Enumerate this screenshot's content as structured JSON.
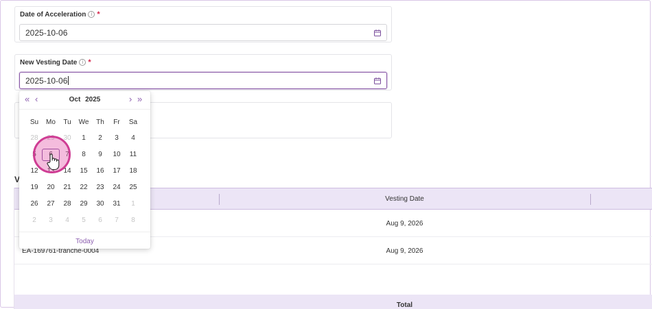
{
  "form": {
    "acceleration": {
      "label": "Date of Acceleration",
      "info_icon": "info-icon",
      "required_mark": "*",
      "value": "2025-10-06"
    },
    "new_vesting": {
      "label": "New Vesting Date",
      "info_icon": "info-icon",
      "required_mark": "*",
      "value": "2025-10-06"
    }
  },
  "calendar": {
    "nav": {
      "prev_year": "«",
      "prev_month": "‹",
      "next_month": "›",
      "next_year": "»"
    },
    "month": "Oct",
    "year": "2025",
    "weekdays": [
      "Su",
      "Mo",
      "Tu",
      "We",
      "Th",
      "Fr",
      "Sa"
    ],
    "weeks": [
      [
        "28",
        "29",
        "30",
        "1",
        "2",
        "3",
        "4"
      ],
      [
        "5",
        "6",
        "7",
        "8",
        "9",
        "10",
        "11"
      ],
      [
        "12",
        "13",
        "14",
        "15",
        "16",
        "17",
        "18"
      ],
      [
        "19",
        "20",
        "21",
        "22",
        "23",
        "24",
        "25"
      ],
      [
        "26",
        "27",
        "28",
        "29",
        "30",
        "31",
        "1"
      ],
      [
        "2",
        "3",
        "4",
        "5",
        "6",
        "7",
        "8"
      ]
    ],
    "selected_day": "6",
    "today_label": "Today"
  },
  "table": {
    "section_heading": "V",
    "columns": [
      "",
      "Vesting Date",
      ""
    ],
    "rows": [
      {
        "name": "",
        "vesting_date": "Aug 9, 2026"
      },
      {
        "name": "EA-169761-tranche-0004",
        "vesting_date": "Aug 9, 2026"
      }
    ],
    "footer_label": "Total"
  },
  "colors": {
    "accent": "#8d5fb0",
    "required": "#d6244a",
    "table_header_bg": "#ece5f6",
    "click_highlight": "#cf3d94"
  },
  "icons": {
    "calendar": "calendar-icon",
    "cursor": "hand-pointer-icon"
  }
}
